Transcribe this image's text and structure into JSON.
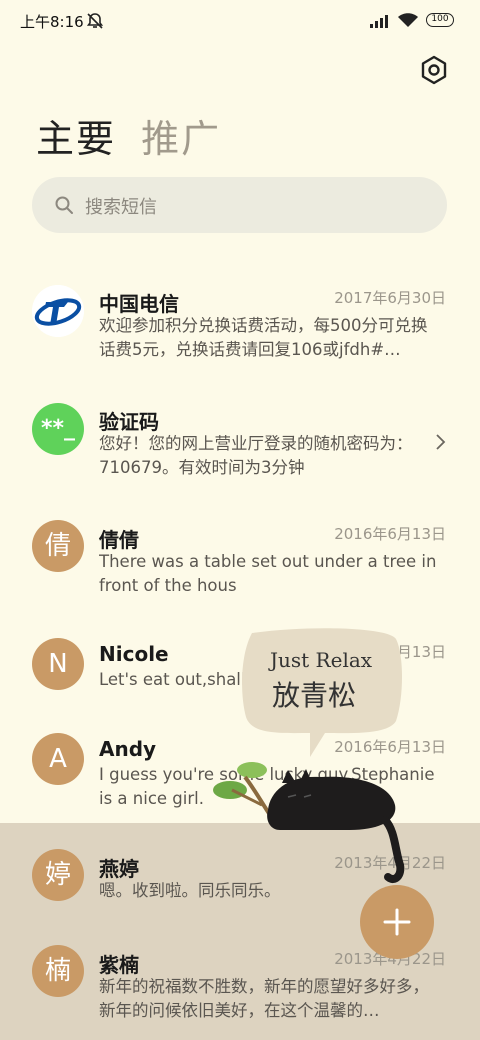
{
  "status_bar": {
    "time": "上午8:16",
    "battery": "100"
  },
  "tabs": [
    {
      "label": "主要"
    },
    {
      "label": "推广"
    }
  ],
  "search": {
    "placeholder": "搜索短信"
  },
  "messages": [
    {
      "sender": "中国电信",
      "date": "2017年6月30日",
      "preview": "欢迎参加积分兑换话费活动，每500分可兑换话费5元，兑换话费请回复106或jfdh#…"
    },
    {
      "sender": "验证码",
      "avatar_text": "**_",
      "date": "",
      "preview": "您好！您的网上营业厅登录的随机密码为：710679。有效时间为3分钟"
    },
    {
      "sender": "倩倩",
      "avatar_text": "倩",
      "date": "2016年6月13日",
      "preview": "There was a table set out under a tree in front of the hous"
    },
    {
      "sender": "Nicole",
      "avatar_text": "N",
      "date": "2016年6月13日",
      "preview": "Let's eat out,shall we?"
    },
    {
      "sender": "Andy",
      "avatar_text": "A",
      "date": "2016年6月13日",
      "preview": "I guess you're some lucky guy.Stephanie is a nice girl."
    },
    {
      "sender": "燕婷",
      "avatar_text": "婷",
      "date": "2013年4月22日",
      "preview": "嗯。收到啦。同乐同乐。"
    },
    {
      "sender": "紫楠",
      "avatar_text": "楠",
      "date": "2013年4月22日",
      "preview": "新年的祝福数不胜数，新年的愿望好多好多，新年的问候依旧美好，在这个温馨的…"
    }
  ],
  "sticker": {
    "line1": "Just Relax",
    "line2": "放青松"
  },
  "colors": {
    "background": "#fdfae8",
    "accent": "#c99a66",
    "bottom_band": "#ddd3c0",
    "verify_green": "#5fd25a",
    "telecom_blue": "#0a4fa3"
  },
  "icons": {
    "settings": "hexagon-gear-icon",
    "search": "search-icon",
    "fab": "plus-icon"
  }
}
